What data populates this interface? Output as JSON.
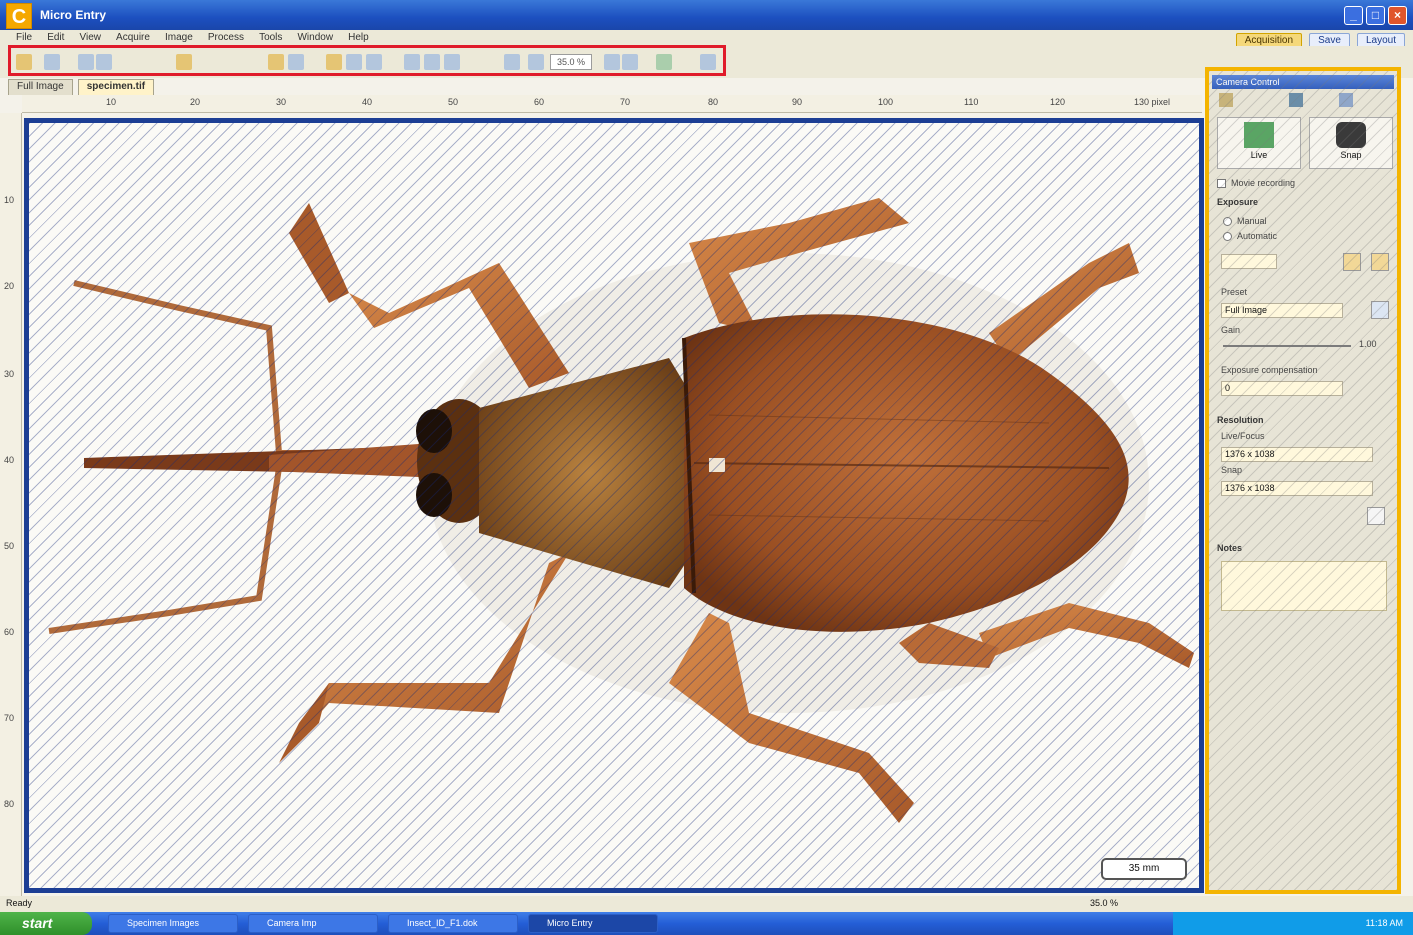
{
  "panel_label": "C",
  "window": {
    "title": "Micro Entry"
  },
  "menu": [
    "File",
    "Edit",
    "View",
    "Acquire",
    "Image",
    "Process",
    "Tools",
    "Window",
    "Help"
  ],
  "top_tabs": [
    {
      "label": "Acquisition",
      "active": true
    },
    {
      "label": "Save",
      "active": false
    },
    {
      "label": "Layout",
      "active": false
    }
  ],
  "toolbar": {
    "zoom_value": "35.0 %"
  },
  "doc_tabs": [
    {
      "label": "Full Image",
      "active": false
    },
    {
      "label": "specimen.tif",
      "active": true
    }
  ],
  "ruler_h": [
    "10",
    "20",
    "30",
    "40",
    "50",
    "60",
    "70",
    "80",
    "90",
    "100",
    "110",
    "120",
    "130  pixel"
  ],
  "ruler_v": [
    "10",
    "20",
    "30",
    "40",
    "50",
    "60",
    "70",
    "80"
  ],
  "canvas": {
    "zoom_stamp": "35 mm"
  },
  "panel": {
    "title": "Camera Control",
    "live_label": "Live",
    "snap_label": "Snap",
    "movie_label": "Movie recording",
    "exposure_title": "Exposure",
    "manual_label": "Manual",
    "auto_label": "Automatic",
    "preset_label": "Preset",
    "preset_value": "Full Image",
    "gain_label": "Gain",
    "gain_value": "1.00",
    "exposure_comp_label": "Exposure compensation",
    "exposure_comp_value": "0",
    "resolution_title": "Resolution",
    "live_res_label": "Live/Focus",
    "live_res_value": "1376 x 1038",
    "snap_res_label": "Snap",
    "snap_res_value": "1376 x 1038",
    "notes_title": "Notes"
  },
  "status": {
    "left": "Ready",
    "zoom": "35.0 %"
  },
  "taskbar": {
    "start": "start",
    "tasks": [
      "Specimen Images",
      "Camera Imp",
      "Insect_ID_F1.dok",
      "Micro Entry"
    ],
    "clock": "11:18 AM"
  },
  "colors": {
    "canvas_border": "#1c3e94",
    "toolbar_highlight": "#e01b2a",
    "panel_highlight": "#f4b400",
    "panel_label_bg": "#f5a800"
  }
}
